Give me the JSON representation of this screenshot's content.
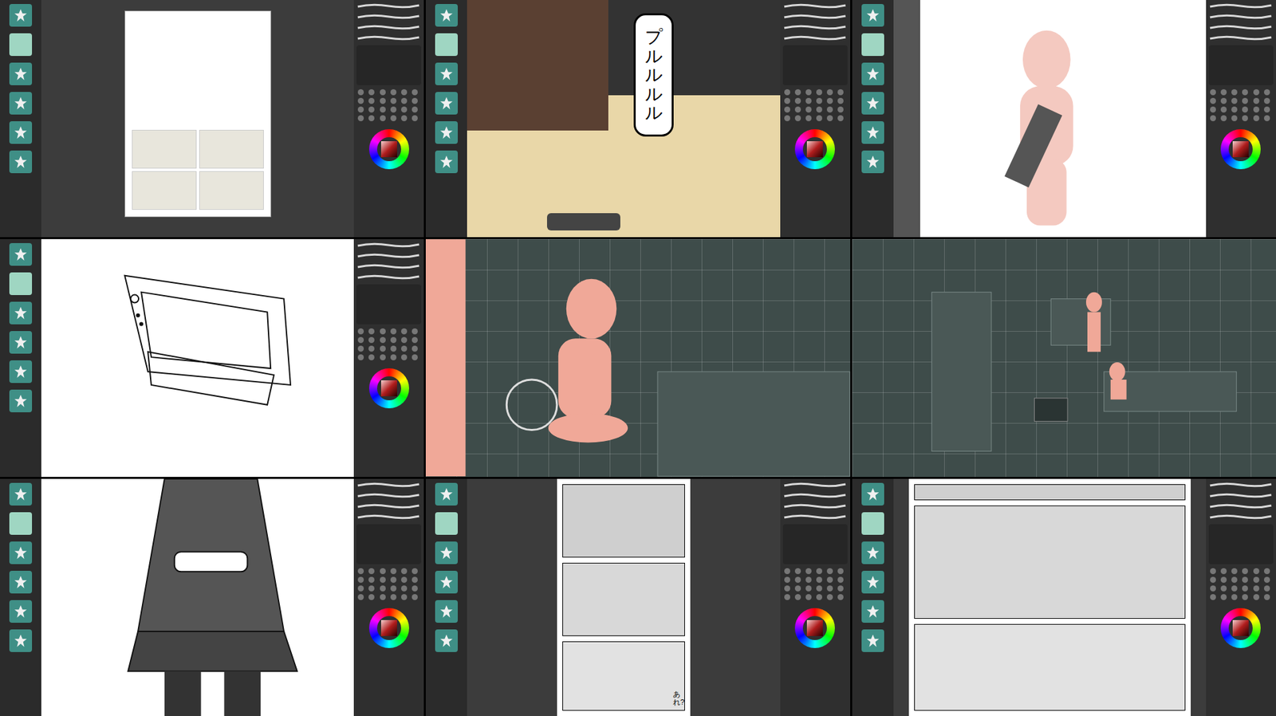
{
  "tiles": [
    {
      "kind": "page",
      "toolbar": true,
      "side_panel": true,
      "text": ""
    },
    {
      "kind": "bubble",
      "toolbar": true,
      "side_panel": true,
      "text": "プルルルル"
    },
    {
      "kind": "figure",
      "toolbar": true,
      "side_panel": true,
      "text": ""
    },
    {
      "kind": "lineart",
      "toolbar": true,
      "side_panel": true,
      "text": ""
    },
    {
      "kind": "3d-close",
      "toolbar": false,
      "side_panel": false,
      "text": ""
    },
    {
      "kind": "3d-room",
      "toolbar": false,
      "side_panel": false,
      "text": ""
    },
    {
      "kind": "character",
      "toolbar": true,
      "side_panel": true,
      "text": ""
    },
    {
      "kind": "panels",
      "toolbar": true,
      "side_panel": true,
      "text": "あれ?"
    },
    {
      "kind": "panels-close",
      "toolbar": true,
      "side_panel": true,
      "text": ""
    }
  ]
}
